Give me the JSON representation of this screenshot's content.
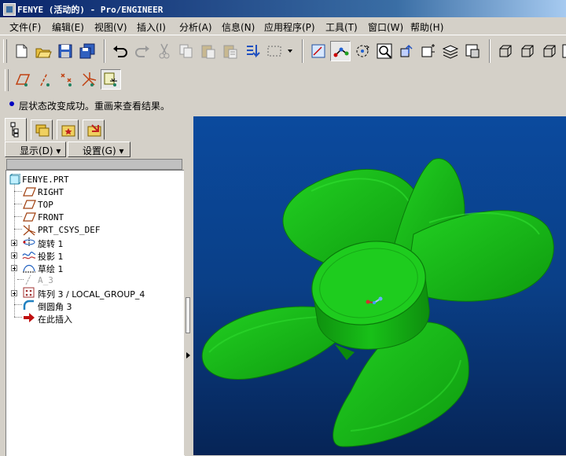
{
  "window": {
    "title": "FENYE (活动的) - Pro/ENGINEER"
  },
  "menu": [
    {
      "label": "文件(F)"
    },
    {
      "label": "编辑(E)"
    },
    {
      "label": "视图(V)"
    },
    {
      "label": "插入(I)"
    },
    {
      "label": "分析(A)"
    },
    {
      "label": "信息(N)"
    },
    {
      "label": "应用程序(P)"
    },
    {
      "label": "工具(T)"
    },
    {
      "label": "窗口(W)"
    },
    {
      "label": "帮助(H)"
    }
  ],
  "status": {
    "message": "层状态改变成功。重画来查看结果。"
  },
  "panel": {
    "tabs": [
      "model-tree-icon",
      "layers-icon",
      "favorites-icon",
      "browser-icon"
    ],
    "show_button": "显示(D) ▾",
    "settings_button": "设置(G) ▾"
  },
  "tree": {
    "root": "FENYE.PRT",
    "items": [
      {
        "label": "RIGHT",
        "icon": "datum-plane-icon"
      },
      {
        "label": "TOP",
        "icon": "datum-plane-icon"
      },
      {
        "label": "FRONT",
        "icon": "datum-plane-icon"
      },
      {
        "label": "PRT_CSYS_DEF",
        "icon": "csys-icon"
      },
      {
        "label": "旋转 1",
        "icon": "revolve-icon"
      },
      {
        "label": "投影 1",
        "icon": "projection-icon"
      },
      {
        "label": "草绘 1",
        "icon": "sketch-icon"
      },
      {
        "label": "A_3",
        "icon": "axis-icon"
      },
      {
        "label": "阵列 3 / LOCAL_GROUP_4",
        "icon": "pattern-icon"
      },
      {
        "label": "倒圆角 3",
        "icon": "round-icon"
      },
      {
        "label": "在此插入",
        "icon": "insert-here-icon"
      }
    ]
  },
  "colors": {
    "viewport_top": "#0b4a9e",
    "viewport_bottom": "#062456",
    "model": "#14b814",
    "model_dark": "#0a7a0a"
  },
  "toolbar_icons": [
    "new-icon",
    "open-icon",
    "save-icon",
    "save-copy-icon",
    "undo-icon",
    "redo-icon",
    "cut-icon",
    "copy-icon",
    "paste-icon",
    "paste-special-icon",
    "regenerate-icon",
    "select-box-icon",
    "sketch-view-icon",
    "datum-csys-display-icon",
    "spin-center-icon",
    "zoom-window-icon",
    "model-display-icon",
    "view-manager-icon",
    "layers-icon",
    "saved-views-icon",
    "wireframe-icon",
    "hidden-line-icon",
    "no-hidden-icon"
  ],
  "toolbar2_icons": [
    "datum-plane-display-icon",
    "axis-display-icon",
    "point-display-icon",
    "csys-display-icon",
    "annotation-display-icon"
  ]
}
